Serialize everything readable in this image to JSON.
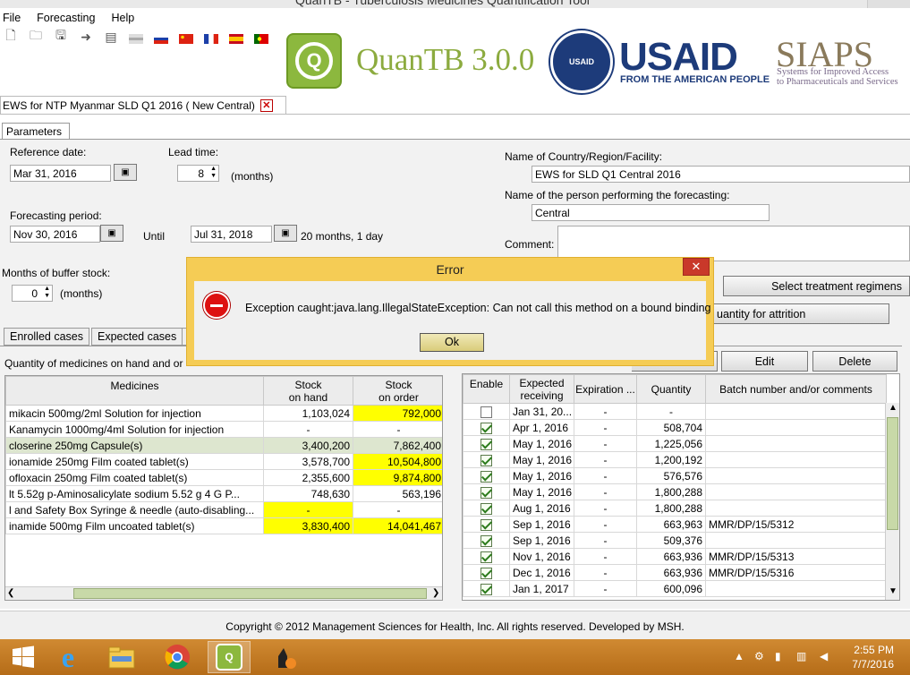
{
  "window": {
    "title": "QuanTB - Tuberculosis Medicines Quantification Tool"
  },
  "menu": [
    "File",
    "Forecasting",
    "Help"
  ],
  "banner": {
    "app_name": "QuanTB 3.0.0",
    "usaid": "USAID",
    "usaid_sub": "FROM THE AMERICAN PEOPLE",
    "siaps": "SIAPS",
    "siaps_sub1": "Systems for Improved Access",
    "siaps_sub2": "to Pharmaceuticals and Services"
  },
  "doc_tab": {
    "label": "EWS for NTP Myanmar  SLD Q1 2016 (  New Central)",
    "close": "✕"
  },
  "params": {
    "tab": "Parameters",
    "reference_date_label": "Reference date:",
    "reference_date": "Mar 31, 2016",
    "lead_time_label": "Lead time:",
    "lead_time": "8",
    "months_unit": "(months)",
    "forecasting_period_label": "Forecasting period:",
    "period_start": "Nov 30, 2016",
    "until_label": "Until",
    "period_end": "Jul 31, 2018",
    "period_duration": "20 months, 1 day",
    "buffer_label": "Months of buffer stock:",
    "buffer_value": "0",
    "buffer_unit": "(months)",
    "country_label": "Name of Country/Region/Facility:",
    "country_value": "EWS for SLD Q1 Central 2016",
    "person_label": "Name of the person performing the forecasting:",
    "person_value": "Central",
    "comment_label": "Comment:",
    "select_regimens": "Select treatment regimens",
    "quantity_attrition": "uantity for attrition"
  },
  "subtabs": [
    "Enrolled cases",
    "Expected cases"
  ],
  "medicines_caption": "Quantity of medicines on hand and or",
  "medicines_table": {
    "headers": {
      "medicines": "Medicines",
      "on_hand_1": "Stock",
      "on_hand_2": "on hand",
      "on_order_1": "Stock",
      "on_order_2": "on order"
    },
    "rows": [
      {
        "name": "mikacin  500mg/2ml  Solution for injection",
        "on_hand": "1,103,024",
        "on_order": "792,000",
        "hand_y": false,
        "order_y": true
      },
      {
        "name": " Kanamycin  1000mg/4ml  Solution for injection",
        "on_hand": "-",
        "on_order": "-",
        "hand_y": false,
        "order_y": false
      },
      {
        "name": "closerine  250mg  Capsule(s)",
        "on_hand": "3,400,200",
        "on_order": "7,862,400",
        "hand_y": false,
        "order_y": false
      },
      {
        "name": "ionamide  250mg  Film coated tablet(s)",
        "on_hand": "3,578,700",
        "on_order": "10,504,800",
        "hand_y": false,
        "order_y": true
      },
      {
        "name": "ofloxacin  250mg  Film coated tablet(s)",
        "on_hand": "2,355,600",
        "on_order": "9,874,800",
        "hand_y": false,
        "order_y": true
      },
      {
        "name": "lt 5.52g   p-Aminosalicylate sodium 5.52 g   4 G P...",
        "on_hand": "748,630",
        "on_order": "563,196",
        "hand_y": false,
        "order_y": false
      },
      {
        "name": "l and Safety Box   Syringe & needle (auto-disabling...",
        "on_hand": "-",
        "on_order": "-",
        "hand_y": true,
        "order_y": false
      },
      {
        "name": "inamide  500mg  Film uncoated tablet(s)",
        "on_hand": "3,830,400",
        "on_order": "14,041,467",
        "hand_y": true,
        "order_y": true
      }
    ]
  },
  "orders_buttons": {
    "edit": "Edit",
    "delete": "Delete"
  },
  "orders_table": {
    "headers": {
      "enable": "Enable",
      "expected_1": "Expected",
      "expected_2": "receiving",
      "expiration": "Expiration ...",
      "quantity": "Quantity",
      "batch": "Batch number and/or comments"
    },
    "rows": [
      {
        "enabled": false,
        "date": "Jan 31, 20...",
        "exp": "-",
        "qty": "-",
        "batch": ""
      },
      {
        "enabled": true,
        "date": "Apr 1, 2016",
        "exp": "-",
        "qty": "508,704",
        "batch": ""
      },
      {
        "enabled": true,
        "date": "May 1, 2016",
        "exp": "-",
        "qty": "1,225,056",
        "batch": ""
      },
      {
        "enabled": true,
        "date": "May 1, 2016",
        "exp": "-",
        "qty": "1,200,192",
        "batch": ""
      },
      {
        "enabled": true,
        "date": "May 1, 2016",
        "exp": "-",
        "qty": "576,576",
        "batch": ""
      },
      {
        "enabled": true,
        "date": "May 1, 2016",
        "exp": "-",
        "qty": "1,800,288",
        "batch": ""
      },
      {
        "enabled": true,
        "date": "Aug 1, 2016",
        "exp": "-",
        "qty": "1,800,288",
        "batch": ""
      },
      {
        "enabled": true,
        "date": "Sep 1, 2016",
        "exp": "-",
        "qty": "663,963",
        "batch": "MMR/DP/15/5312"
      },
      {
        "enabled": true,
        "date": "Sep 1, 2016",
        "exp": "-",
        "qty": "509,376",
        "batch": ""
      },
      {
        "enabled": true,
        "date": "Nov 1, 2016",
        "exp": "-",
        "qty": "663,936",
        "batch": "MMR/DP/15/5313"
      },
      {
        "enabled": true,
        "date": "Dec 1, 2016",
        "exp": "-",
        "qty": "663,936",
        "batch": "MMR/DP/15/5316"
      },
      {
        "enabled": true,
        "date": "Jan 1, 2017",
        "exp": "-",
        "qty": "600,096",
        "batch": ""
      }
    ]
  },
  "dialog": {
    "title": "Error",
    "message": "Exception caught:java.lang.IllegalStateException: Can not call this method on a bound binding",
    "ok": "Ok"
  },
  "footer": "Copyright © 2012 Management Sciences for Health, Inc. All rights reserved. Developed by MSH.",
  "taskbar": {
    "time": "2:55 PM",
    "date": "7/7/2016"
  },
  "colors": {
    "highlight_yellow": "#ffff00",
    "dialog_bg": "#f5cc55",
    "taskbar": "#c07820",
    "quantb_green": "#8cab3f",
    "usaid_blue": "#1d3b7a"
  }
}
